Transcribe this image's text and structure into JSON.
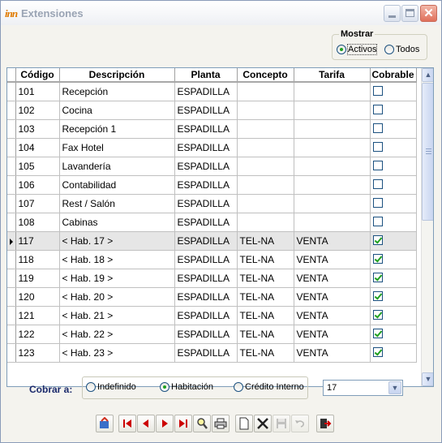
{
  "window": {
    "title": "Extensiones",
    "logo_text": "inn"
  },
  "mostrar": {
    "legend": "Mostrar",
    "options": [
      {
        "label": "Activos",
        "selected": true
      },
      {
        "label": "Todos",
        "selected": false
      }
    ]
  },
  "table": {
    "columns": [
      "Código",
      "Descripción",
      "Planta",
      "Concepto",
      "Tarifa",
      "Cobrable"
    ],
    "rows": [
      {
        "codigo": "101",
        "descripcion": "Recepción",
        "planta": "ESPADILLA",
        "concepto": "",
        "tarifa": "",
        "cobrable": false
      },
      {
        "codigo": "102",
        "descripcion": "Cocina",
        "planta": "ESPADILLA",
        "concepto": "",
        "tarifa": "",
        "cobrable": false
      },
      {
        "codigo": "103",
        "descripcion": "Recepción 1",
        "planta": "ESPADILLA",
        "concepto": "",
        "tarifa": "",
        "cobrable": false
      },
      {
        "codigo": "104",
        "descripcion": "Fax Hotel",
        "planta": "ESPADILLA",
        "concepto": "",
        "tarifa": "",
        "cobrable": false
      },
      {
        "codigo": "105",
        "descripcion": "Lavandería",
        "planta": "ESPADILLA",
        "concepto": "",
        "tarifa": "",
        "cobrable": false
      },
      {
        "codigo": "106",
        "descripcion": "Contabilidad",
        "planta": "ESPADILLA",
        "concepto": "",
        "tarifa": "",
        "cobrable": false
      },
      {
        "codigo": "107",
        "descripcion": "Rest / Salón",
        "planta": "ESPADILLA",
        "concepto": "",
        "tarifa": "",
        "cobrable": false
      },
      {
        "codigo": "108",
        "descripcion": "Cabinas",
        "planta": "ESPADILLA",
        "concepto": "",
        "tarifa": "",
        "cobrable": false
      },
      {
        "codigo": "117",
        "descripcion": "< Hab. 17 >",
        "planta": "ESPADILLA",
        "concepto": "TEL-NA",
        "tarifa": "VENTA",
        "cobrable": true,
        "selected": true
      },
      {
        "codigo": "118",
        "descripcion": "< Hab. 18 >",
        "planta": "ESPADILLA",
        "concepto": "TEL-NA",
        "tarifa": "VENTA",
        "cobrable": true
      },
      {
        "codigo": "119",
        "descripcion": "< Hab. 19 >",
        "planta": "ESPADILLA",
        "concepto": "TEL-NA",
        "tarifa": "VENTA",
        "cobrable": true
      },
      {
        "codigo": "120",
        "descripcion": "< Hab. 20 >",
        "planta": "ESPADILLA",
        "concepto": "TEL-NA",
        "tarifa": "VENTA",
        "cobrable": true
      },
      {
        "codigo": "121",
        "descripcion": "< Hab. 21 >",
        "planta": "ESPADILLA",
        "concepto": "TEL-NA",
        "tarifa": "VENTA",
        "cobrable": true
      },
      {
        "codigo": "122",
        "descripcion": "< Hab. 22 >",
        "planta": "ESPADILLA",
        "concepto": "TEL-NA",
        "tarifa": "VENTA",
        "cobrable": true
      },
      {
        "codigo": "123",
        "descripcion": "< Hab. 23 >",
        "planta": "ESPADILLA",
        "concepto": "TEL-NA",
        "tarifa": "VENTA",
        "cobrable": true
      }
    ]
  },
  "cobrar": {
    "label": "Cobrar a:",
    "options": [
      {
        "label": "Indefinido",
        "selected": false
      },
      {
        "label": "Habitación",
        "selected": true
      },
      {
        "label": "Crédito Interno",
        "selected": false
      }
    ],
    "select_value": "17"
  },
  "toolbar": {
    "buttons": [
      {
        "name": "refresh-button",
        "icon": "refresh-icon"
      },
      {
        "name": "first-record-button",
        "icon": "first-record-icon"
      },
      {
        "name": "previous-record-button",
        "icon": "previous-record-icon"
      },
      {
        "name": "next-record-button",
        "icon": "next-record-icon"
      },
      {
        "name": "last-record-button",
        "icon": "last-record-icon"
      },
      {
        "name": "search-button",
        "icon": "search-icon"
      },
      {
        "name": "print-button",
        "icon": "print-icon"
      },
      {
        "name": "new-button",
        "icon": "new-document-icon"
      },
      {
        "name": "delete-button",
        "icon": "delete-icon"
      },
      {
        "name": "save-button",
        "icon": "save-icon"
      },
      {
        "name": "undo-button",
        "icon": "undo-icon"
      },
      {
        "name": "exit-button",
        "icon": "exit-icon"
      }
    ]
  },
  "colors": {
    "accent": "#1b2a6c",
    "check": "#21a121",
    "nav": "#cc0000"
  }
}
